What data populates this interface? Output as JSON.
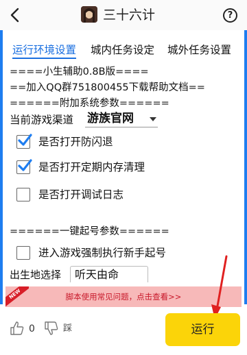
{
  "header": {
    "title": "三十六计"
  },
  "tabs": [
    {
      "label": "运行环境设置",
      "active": true
    },
    {
      "label": "城内任务设定",
      "active": false
    },
    {
      "label": "城外任务设置",
      "active": false
    }
  ],
  "info_lines": [
    "====小生辅助0.8B版====",
    "==加入QQ群751800455下载帮助文档==",
    "======附加系统参数======"
  ],
  "channel": {
    "label": "当前游戏渠道",
    "value": "游族官网"
  },
  "options": [
    {
      "label": "是否打开防闪退",
      "checked": true
    },
    {
      "label": "是否打开定期内存清理",
      "checked": true
    },
    {
      "label": "是否打开调试日志",
      "checked": false
    }
  ],
  "section2": {
    "title": "======一键起号参数======",
    "option": {
      "label": "进入游戏强制执行新手起号",
      "checked": false
    }
  },
  "cut_row": {
    "label": "出生地选择",
    "value": "听天由命"
  },
  "notice": {
    "tag": "NEW",
    "text": "脚本使用常见问题，点击查看>>"
  },
  "footer": {
    "like_count": "0",
    "dislike_label": "踩",
    "run_label": "运行"
  },
  "colors": {
    "accent": "#1e7df0",
    "run_button": "#fbd409",
    "notice_bg": "#f7b9b9",
    "notice_text": "#c8192a"
  }
}
